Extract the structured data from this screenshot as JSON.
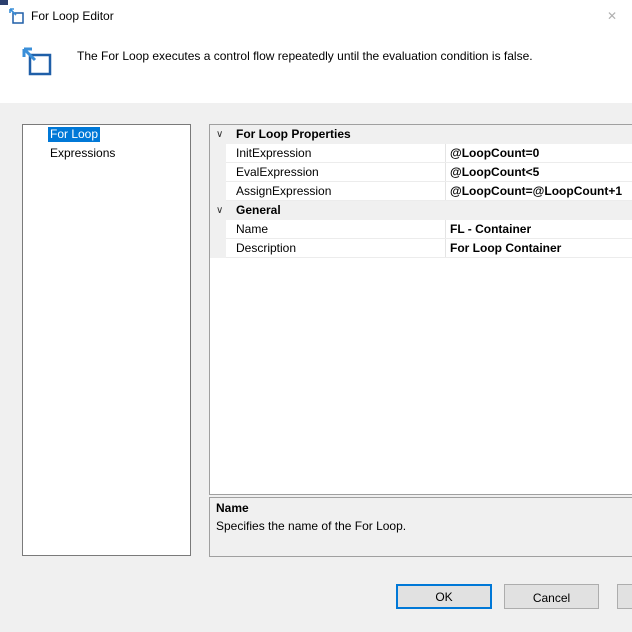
{
  "window": {
    "title": "For Loop Editor",
    "close_glyph": "✕"
  },
  "header": {
    "description": "The For Loop executes a control flow repeatedly until the evaluation condition is false."
  },
  "nav": {
    "items": [
      {
        "label": "For Loop",
        "selected": true
      },
      {
        "label": "Expressions",
        "selected": false
      }
    ]
  },
  "grid": {
    "categories": [
      {
        "label": "For Loop Properties",
        "properties": [
          {
            "name": "InitExpression",
            "value": "@LoopCount=0"
          },
          {
            "name": "EvalExpression",
            "value": "@LoopCount<5"
          },
          {
            "name": "AssignExpression",
            "value": "@LoopCount=@LoopCount+1"
          }
        ]
      },
      {
        "label": "General",
        "properties": [
          {
            "name": "Name",
            "value": "FL - Container"
          },
          {
            "name": "Description",
            "value": "For Loop Container"
          }
        ]
      }
    ]
  },
  "description_panel": {
    "title": "Name",
    "text": "Specifies the name of the For Loop."
  },
  "buttons": {
    "ok": "OK",
    "cancel": "Cancel"
  },
  "colors": {
    "selection": "#0078d7",
    "dialog_bg": "#f0f0f0"
  },
  "icons": {
    "window": "for-loop-window-icon",
    "header": "for-loop-editor-icon",
    "expander": "chevron-down-icon"
  }
}
